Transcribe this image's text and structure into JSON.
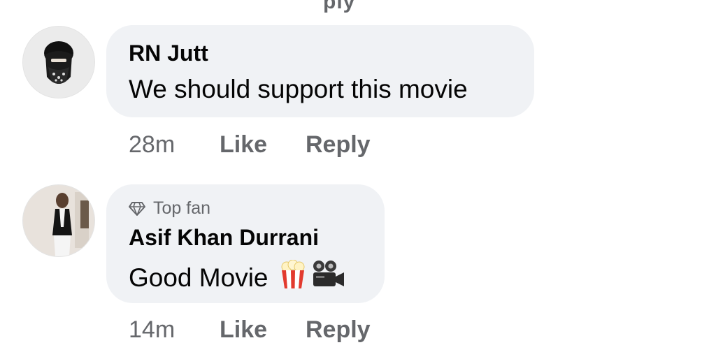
{
  "top_partial_text": "ply",
  "comments": [
    {
      "author": "RN Jutt",
      "text": "We should support this movie",
      "time": "28m",
      "like_label": "Like",
      "reply_label": "Reply"
    },
    {
      "badge": "Top fan",
      "author": "Asif Khan Durrani",
      "text": "Good Movie",
      "emojis": [
        "popcorn-emoji",
        "movie-camera-emoji"
      ],
      "time": "14m",
      "like_label": "Like",
      "reply_label": "Reply"
    }
  ],
  "colors": {
    "bubble": "#f0f2f5",
    "secondary_text": "#65676b",
    "primary_text": "#050505"
  }
}
